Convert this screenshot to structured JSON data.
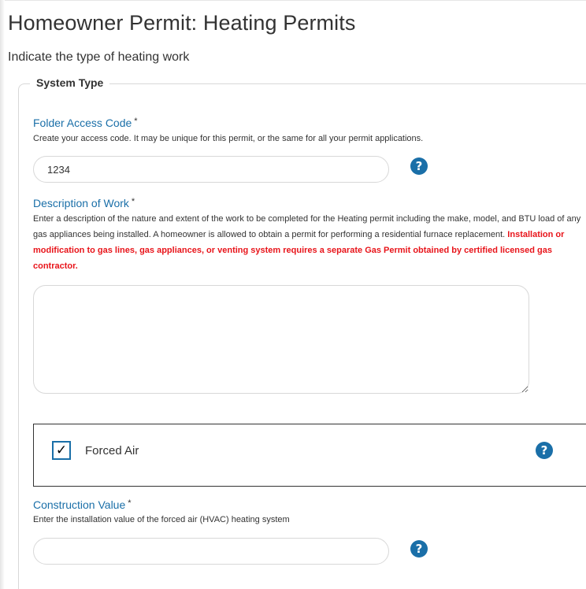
{
  "page": {
    "title": "Homeowner Permit: Heating Permits",
    "subtitle": "Indicate the type of heating work"
  },
  "fieldset": {
    "legend": "System Type"
  },
  "folder_access": {
    "label": "Folder Access Code",
    "required_mark": "*",
    "help": "Create your access code. It may be unique for this permit, or the same for all your permit applications.",
    "value": "1234",
    "help_icon": "question-circle-icon"
  },
  "description": {
    "label": "Description of Work",
    "required_mark": "*",
    "help": "Enter a description of the nature and extent of the work to be completed for the Heating permit including the make, model, and BTU load of any gas appliances being installed. A homeowner is allowed to obtain a permit for performing a residential furnace replacement.",
    "warning": "Installation or modification to gas lines, gas appliances, or venting system requires a separate Gas Permit obtained by certified licensed gas contractor.",
    "value": ""
  },
  "forced_air": {
    "label": "Forced Air",
    "checked": true,
    "check_glyph": "✓",
    "help_icon": "question-circle-icon"
  },
  "construction_value": {
    "label": "Construction Value",
    "required_mark": "*",
    "help": "Enter the installation value of the forced air (HVAC) heating system",
    "value": "",
    "help_icon": "question-circle-icon"
  },
  "icons": {
    "help_glyph": "?"
  },
  "colors": {
    "accent": "#1a6fa8",
    "warning": "#e8141a",
    "text": "#333333",
    "border": "#d8d8d8"
  }
}
